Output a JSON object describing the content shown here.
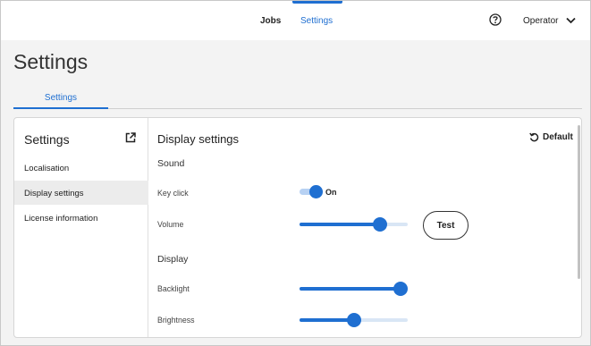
{
  "topbar": {
    "nav": [
      {
        "label": "Jobs"
      },
      {
        "label": "Settings"
      }
    ],
    "user": "Operator"
  },
  "page": {
    "title": "Settings",
    "tabs": [
      {
        "label": "Settings"
      }
    ]
  },
  "sidebar": {
    "title": "Settings",
    "items": [
      {
        "label": "Localisation"
      },
      {
        "label": "Display settings"
      },
      {
        "label": "License information"
      }
    ],
    "selected_index": 1
  },
  "content": {
    "title": "Display settings",
    "default_label": "Default",
    "sound": {
      "heading": "Sound",
      "key_click": {
        "label": "Key click",
        "state": "On",
        "enabled": true
      },
      "volume": {
        "label": "Volume",
        "value_fraction": 0.78
      },
      "test_label": "Test"
    },
    "display": {
      "heading": "Display",
      "backlight": {
        "label": "Backlight",
        "value_fraction": 1.0
      },
      "brightness": {
        "label": "Brightness",
        "value_fraction": 0.5
      }
    }
  },
  "colors": {
    "accent": "#1f6fd1",
    "track_light": "#d9e6f5",
    "selected_bg": "#ececec"
  }
}
